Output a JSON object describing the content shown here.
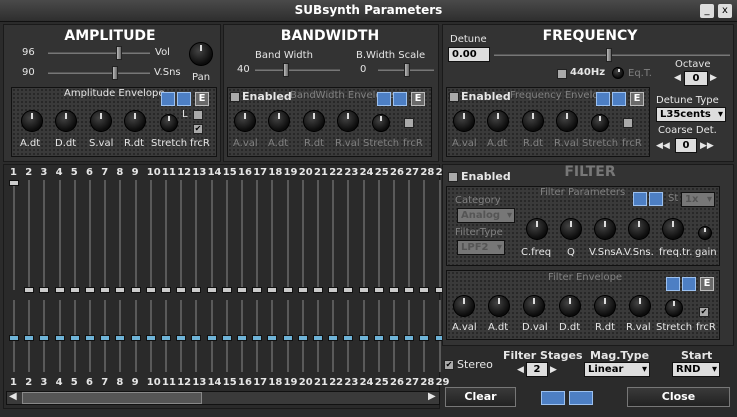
{
  "window": {
    "title": "SUBsynth Parameters",
    "minimize": "_",
    "close": "x"
  },
  "amplitude": {
    "title": "AMPLITUDE",
    "vol_value": "96",
    "vol_label": "Vol",
    "vsns_value": "90",
    "vsns_label": "V.Sns",
    "pan_label": "Pan",
    "env_title": "Amplitude Envelope",
    "e_button": "E",
    "l_label": "L",
    "knobs": [
      "A.dt",
      "D.dt",
      "S.val",
      "R.dt",
      "Stretch",
      "frcR"
    ]
  },
  "bandwidth": {
    "title": "BANDWIDTH",
    "bw_label": "Band Width",
    "bw_value": "40",
    "scale_label": "B.Width Scale",
    "scale_value": "0",
    "enabled_label": "Enabled",
    "env_title": "BandWidth Envelope",
    "e_button": "E",
    "knobs": [
      "A.val",
      "A.dt",
      "R.dt",
      "R.val",
      "Stretch",
      "frcR"
    ]
  },
  "frequency": {
    "title": "FREQUENCY",
    "detune_label": "Detune",
    "detune_value": "0.00",
    "hz_label": "440Hz",
    "eqt_label": "Eq.T.",
    "octave_label": "Octave",
    "octave_value": "0",
    "enabled_label": "Enabled",
    "env_title": "Frequency Envelope",
    "e_button": "E",
    "knobs": [
      "A.val",
      "A.dt",
      "R.dt",
      "R.val",
      "Stretch",
      "frcR"
    ],
    "detune_type_label": "Detune Type",
    "detune_type_value": "L35cents",
    "coarse_label": "Coarse Det.",
    "coarse_value": "0"
  },
  "filter": {
    "title": "FILTER",
    "enabled_label": "Enabled",
    "params_title": "Filter Parameters",
    "st_label": "St",
    "mult_value": "1x",
    "category_label": "Category",
    "category_value": "Analog",
    "filtertype_label": "FilterType",
    "filtertype_value": "LPF2",
    "knobs": [
      "C.freq",
      "Q",
      "V.SnsA.",
      "V.Sns.",
      "freq.tr.",
      "gain"
    ],
    "env_title": "Filter Envelope",
    "e_button": "E",
    "env_knobs": [
      "A.val",
      "A.dt",
      "D.val",
      "D.dt",
      "R.dt",
      "R.val",
      "Stretch",
      "frcR"
    ]
  },
  "harmonics": {
    "numbers": [
      "1",
      "2",
      "3",
      "4",
      "5",
      "6",
      "7",
      "8",
      "9",
      "10",
      "11",
      "12",
      "13",
      "14",
      "15",
      "16",
      "17",
      "18",
      "19",
      "20",
      "21",
      "22",
      "23",
      "24",
      "25",
      "26",
      "27",
      "28",
      "29"
    ]
  },
  "bottom": {
    "stereo_label": "Stereo",
    "stages_label": "Filter Stages",
    "stages_value": "2",
    "magtype_label": "Mag.Type",
    "magtype_value": "Linear",
    "start_label": "Start",
    "start_value": "RND",
    "clear_label": "Clear",
    "close_label": "Close",
    "scroll_left": "◀",
    "scroll_right": "▶"
  }
}
